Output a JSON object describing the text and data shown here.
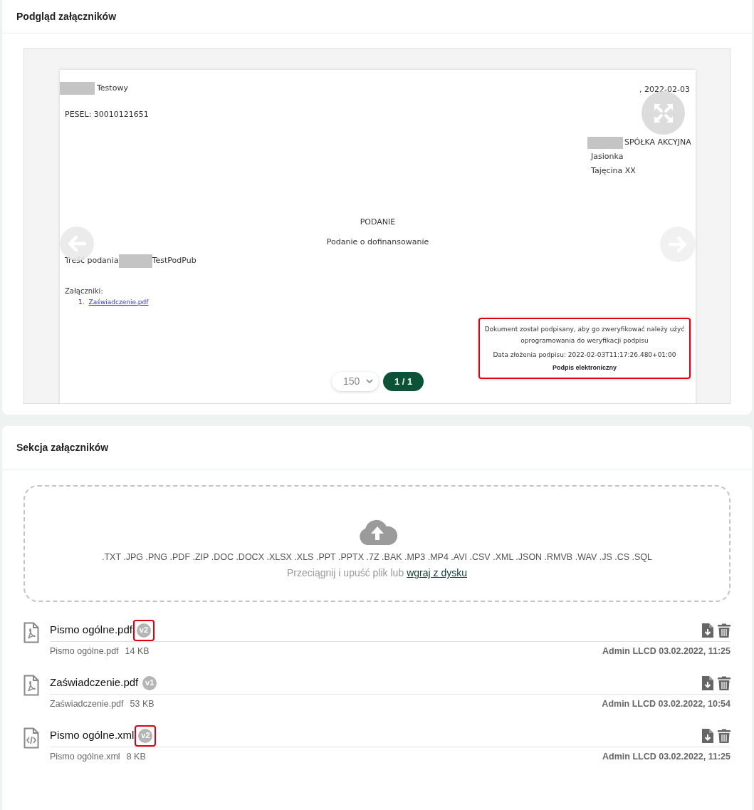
{
  "preview": {
    "title": "Podgląd załączników",
    "document": {
      "sender": "Testowy",
      "date": ", 2022-02-03",
      "pesel": "PESEL: 30010121651",
      "recipient_lines": [
        "SPÓŁKA AKCYJNA",
        "Jasionka",
        "Tajęcina XX"
      ],
      "heading": "PODANIE",
      "subject": "Podanie o dofinansowanie",
      "body_label": "Treść podania",
      "body_value": "TestPodPub",
      "attachments_label": "Załączniki:",
      "attachments": [
        {
          "number": "1.",
          "name": "Zaświadczenie.pdf"
        }
      ],
      "signature": {
        "highlighted": true,
        "lines": [
          "Dokument został podpisany, aby go zweryfikować należy użyć oprogramowania do weryfikacji podpisu",
          "Data złożenia podpisu: 2022-02-03T11:17:26.480+01:00"
        ],
        "title": "Podpis elektroniczny"
      }
    },
    "zoom": "150",
    "page": "1 / 1"
  },
  "attachments_section": {
    "title": "Sekcja załączników",
    "dropzone": {
      "formats": ".TXT .JPG .PNG .PDF .ZIP .DOC .DOCX .XLSX .XLS .PPT .PPTX .7Z .BAK .MP3 .MP4 .AVI .CSV .XML .JSON .RMVB .WAV .JS .CS .SQL",
      "prompt": "Przeciągnij i upuść plik lub",
      "link": "wgraj z dysku"
    },
    "files": [
      {
        "kind": "pdf",
        "name": "Pismo ogólne.pdf",
        "version": "v2",
        "highlighted": true,
        "filename": "Pismo ogólne.pdf",
        "size": "14 KB",
        "meta": "Admin LLCD 03.02.2022, 11:25"
      },
      {
        "kind": "pdf",
        "name": "Zaświadczenie.pdf",
        "version": "v1",
        "highlighted": false,
        "filename": "Zaświadczenie.pdf",
        "size": "53 KB",
        "meta": "Admin LLCD 03.02.2022, 10:54"
      },
      {
        "kind": "xml",
        "name": "Pismo ogólne.xml",
        "version": "v2",
        "highlighted": true,
        "filename": "Pismo ogólne.xml",
        "size": "8 KB",
        "meta": "Admin LLCD 03.02.2022, 11:25"
      }
    ]
  }
}
